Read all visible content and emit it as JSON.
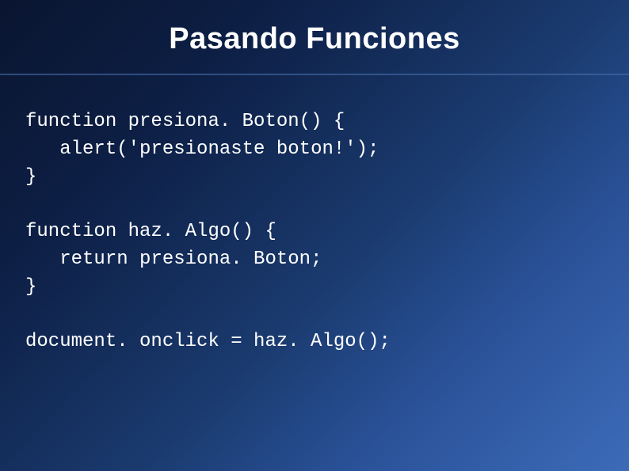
{
  "slide": {
    "title": "Pasando Funciones",
    "code": {
      "line1": "function presiona. Boton() {",
      "line2_indent": "   ",
      "line2": "alert('presionaste boton!');",
      "line3": "}",
      "line4": "",
      "line5": "function haz. Algo() {",
      "line6_indent": "   ",
      "line6": "return presiona. Boton;",
      "line7": "}",
      "line8": "",
      "line9": "document. onclick = haz. Algo();"
    }
  }
}
